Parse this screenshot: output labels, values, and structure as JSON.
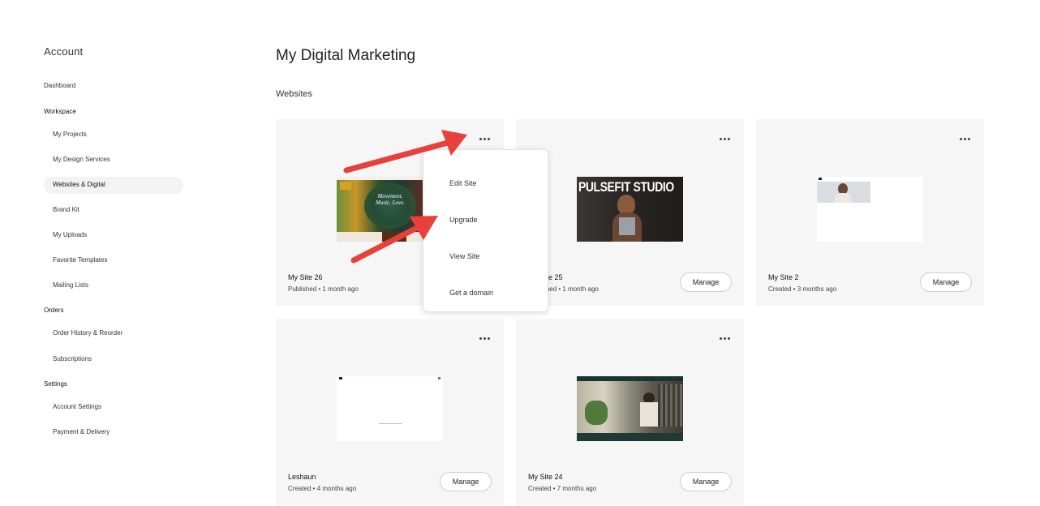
{
  "sidebar": {
    "title": "Account",
    "items": {
      "dashboard": "Dashboard",
      "workspace": "Workspace",
      "my_projects": "My Projects",
      "my_design_services": "My Design Services",
      "websites_digital": "Websites & Digital",
      "brand_kit": "Brand Kit",
      "my_uploads": "My Uploads",
      "favorite_templates": "Favorite Templates",
      "mailing_lists": "Mailing Lists",
      "orders": "Orders",
      "order_history": "Order History & Reorder",
      "subscriptions": "Subscriptions",
      "settings": "Settings",
      "account_settings": "Account Settings",
      "payment_delivery": "Payment & Delivery"
    }
  },
  "main": {
    "title": "My Digital Marketing",
    "section": "Websites",
    "manage_label": "Manage",
    "sites": [
      {
        "name": "My Site 26",
        "status": "Published • 1 month ago",
        "thumb_text": "Movement. Music. Love."
      },
      {
        "name": "My Site 25",
        "status": "Published • 1 month ago",
        "thumb_text": "PULSEFIT STUDIO"
      },
      {
        "name": "My Site 2",
        "status": "Created • 3 months ago"
      },
      {
        "name": "Leshaun",
        "status": "Created • 4 months ago"
      },
      {
        "name": "My Site 24",
        "status": "Created • 7 months ago"
      }
    ]
  },
  "menu": {
    "edit_site": "Edit Site",
    "upgrade": "Upgrade",
    "view_site": "View Site",
    "get_domain": "Get a domain"
  },
  "colors": {
    "card_bg": "#f6f6f6",
    "annotation_arrow": "#e8413c"
  }
}
